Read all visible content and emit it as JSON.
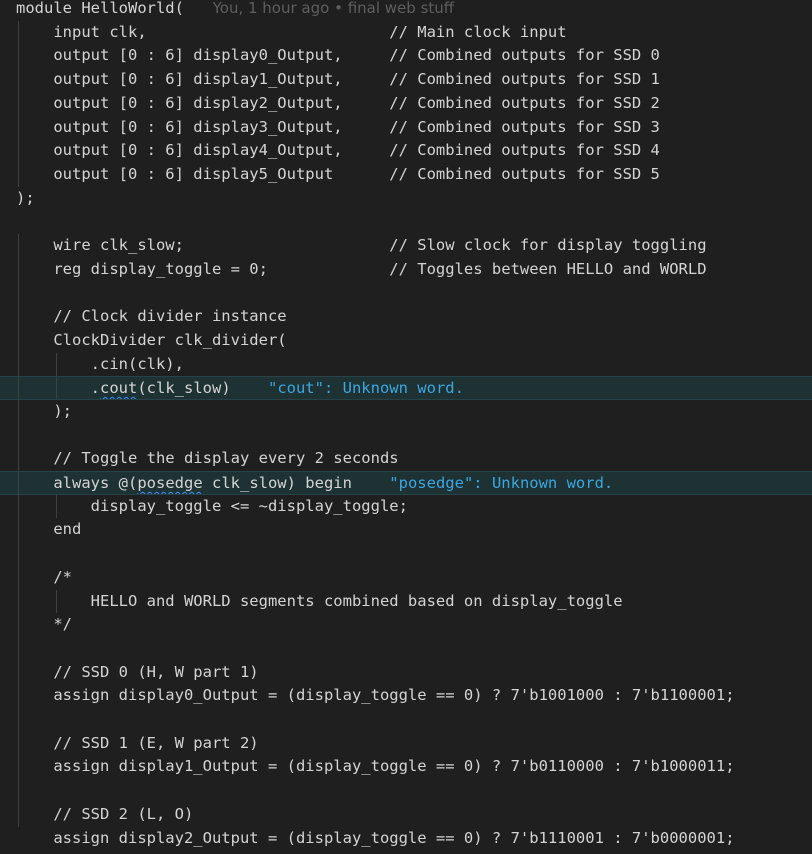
{
  "editor": {
    "lines": [
      {
        "segments": [
          {
            "text": "module HelloWorld(",
            "kind": "code"
          },
          {
            "text": "      You, 1 hour ago • final web stuff",
            "kind": "blame"
          }
        ]
      },
      {
        "segments": [
          {
            "text": "    input clk,                          // Main clock input",
            "kind": "code"
          }
        ]
      },
      {
        "segments": [
          {
            "text": "    output [0 : 6] display0_Output,     // Combined outputs for SSD 0",
            "kind": "code"
          }
        ]
      },
      {
        "segments": [
          {
            "text": "    output [0 : 6] display1_Output,     // Combined outputs for SSD 1",
            "kind": "code"
          }
        ]
      },
      {
        "segments": [
          {
            "text": "    output [0 : 6] display2_Output,     // Combined outputs for SSD 2",
            "kind": "code"
          }
        ]
      },
      {
        "segments": [
          {
            "text": "    output [0 : 6] display3_Output,     // Combined outputs for SSD 3",
            "kind": "code"
          }
        ]
      },
      {
        "segments": [
          {
            "text": "    output [0 : 6] display4_Output,     // Combined outputs for SSD 4",
            "kind": "code"
          }
        ]
      },
      {
        "segments": [
          {
            "text": "    output [0 : 6] display5_Output      // Combined outputs for SSD 5",
            "kind": "code"
          }
        ]
      },
      {
        "segments": [
          {
            "text": ");",
            "kind": "code"
          }
        ]
      },
      {
        "segments": []
      },
      {
        "segments": [
          {
            "text": "    wire clk_slow;                      // Slow clock for display toggling",
            "kind": "code"
          }
        ]
      },
      {
        "segments": [
          {
            "text": "    reg display_toggle = 0;             // Toggles between HELLO and WORLD",
            "kind": "code"
          }
        ]
      },
      {
        "segments": []
      },
      {
        "segments": [
          {
            "text": "    // Clock divider instance",
            "kind": "code"
          }
        ]
      },
      {
        "segments": [
          {
            "text": "    ClockDivider clk_divider(",
            "kind": "code"
          }
        ]
      },
      {
        "segments": [
          {
            "text": "        .cin(clk),",
            "kind": "code"
          }
        ]
      },
      {
        "highlight": true,
        "segments": [
          {
            "text": "        .",
            "kind": "code"
          },
          {
            "text": "cout",
            "kind": "squig"
          },
          {
            "text": "(clk_slow)    ",
            "kind": "code"
          },
          {
            "text": "\"cout\": Unknown word.",
            "kind": "diag"
          }
        ]
      },
      {
        "segments": [
          {
            "text": "    );",
            "kind": "code"
          }
        ]
      },
      {
        "segments": []
      },
      {
        "segments": [
          {
            "text": "    // Toggle the display every 2 seconds",
            "kind": "code"
          }
        ]
      },
      {
        "highlight": true,
        "segments": [
          {
            "text": "    always @(",
            "kind": "code"
          },
          {
            "text": "posedge",
            "kind": "squig"
          },
          {
            "text": " clk_slow) begin    ",
            "kind": "code"
          },
          {
            "text": "\"posedge\": Unknown word.",
            "kind": "diag"
          }
        ]
      },
      {
        "segments": [
          {
            "text": "        display_toggle <= ~display_toggle;",
            "kind": "code"
          }
        ]
      },
      {
        "segments": [
          {
            "text": "    end",
            "kind": "code"
          }
        ]
      },
      {
        "segments": []
      },
      {
        "segments": [
          {
            "text": "    /*",
            "kind": "code"
          }
        ]
      },
      {
        "segments": [
          {
            "text": "        HELLO and WORLD segments combined based on display_toggle",
            "kind": "code"
          }
        ]
      },
      {
        "segments": [
          {
            "text": "    */",
            "kind": "code"
          }
        ]
      },
      {
        "segments": []
      },
      {
        "segments": [
          {
            "text": "    // SSD 0 (H, W part 1)",
            "kind": "code"
          }
        ]
      },
      {
        "segments": [
          {
            "text": "    assign display0_Output = (display_toggle == 0) ? 7'b1001000 : 7'b1100001;",
            "kind": "code"
          }
        ]
      },
      {
        "segments": []
      },
      {
        "segments": [
          {
            "text": "    // SSD 1 (E, W part 2)",
            "kind": "code"
          }
        ]
      },
      {
        "segments": [
          {
            "text": "    assign display1_Output = (display_toggle == 0) ? 7'b0110000 : 7'b1000011;",
            "kind": "code"
          }
        ]
      },
      {
        "segments": []
      },
      {
        "segments": [
          {
            "text": "    // SSD 2 (L, O)",
            "kind": "code"
          }
        ]
      },
      {
        "segments": [
          {
            "text": "    assign display2_Output = (display_toggle == 0) ? 7'b1110001 : 7'b0000001;",
            "kind": "code"
          }
        ]
      }
    ]
  }
}
